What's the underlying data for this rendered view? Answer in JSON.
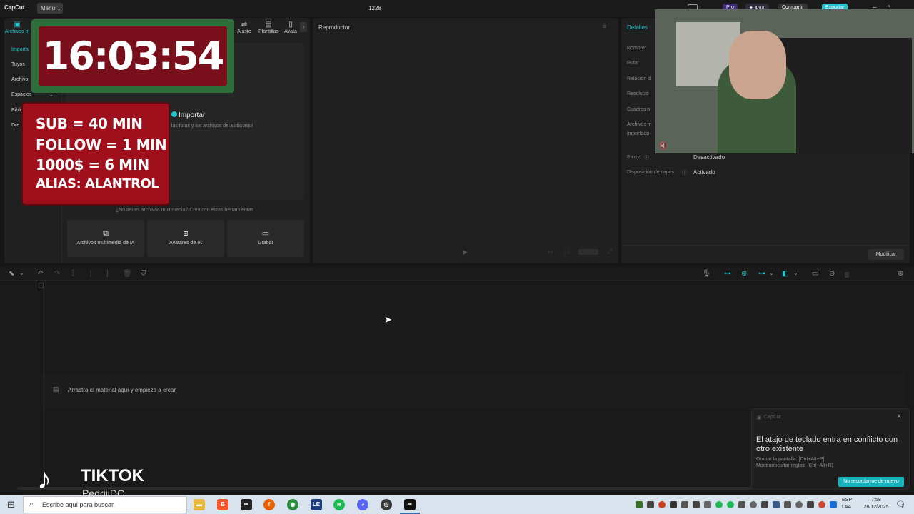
{
  "titlebar": {
    "logo": "CapCut",
    "menu_label": "Menú",
    "project_title": "1228",
    "pro_label": "Pro",
    "credits": "4600",
    "share_label": "Compartir",
    "export_label": "Exportar"
  },
  "media_panel": {
    "tabs": [
      {
        "label": "Archivos m",
        "icon": "media-icon"
      },
      {
        "label": "Ajuste",
        "icon": "adjust-icon"
      },
      {
        "label": "Plantillas",
        "icon": "templates-icon"
      },
      {
        "label": "Avata",
        "icon": "avatar-icon"
      }
    ],
    "sidebar": [
      "Importa",
      "Tuyos",
      "Archivo",
      "Espacios",
      "Bibli",
      "Dre"
    ],
    "import_label": "Importar",
    "import_hint": ", las fotos y los archivos de audio aquí",
    "no_media_text": "¿No tienes archivos multimedia? Crea con estas herramientas",
    "tools": [
      {
        "label": "Archivos multimedia de IA",
        "icon": "ai-media-icon"
      },
      {
        "label": "Avatares de IA",
        "icon": "ai-avatar-icon"
      },
      {
        "label": "Grabar",
        "icon": "record-icon"
      }
    ]
  },
  "player": {
    "title": "Reproductor"
  },
  "details": {
    "title": "Detalles",
    "labels": [
      "Nombre:",
      "Ruta:",
      "Relación d",
      "Resolució",
      "Cuadros p",
      "Archivos m",
      "importado"
    ],
    "proxy_label": "Proxy:",
    "proxy_value": "Desactivado",
    "layers_label": "Disposición de capas",
    "layers_value": "Activado",
    "modify_label": "Modificar"
  },
  "timeline": {
    "drop_hint": "Arrastra el material aquí y empieza a crear"
  },
  "toast": {
    "app": "CapCut",
    "title": "El atajo de teclado entra en conflicto con otro existente",
    "line1": "Grabar la pantalla: [Ctrl+Alt+P]",
    "line2": "Mostrar/ocultar reglas: [Ctrl+Alt+R]",
    "button": "No recordarme de nuevo"
  },
  "overlays": {
    "timer": "16:03:54",
    "rules": [
      "SUB = 40 MIN",
      "FOLLOW = 1 MIN",
      "1000$ = 6 MIN",
      "ALIAS: ALANTROL"
    ],
    "tiktok": "TIKTOK",
    "tiktok_user": "PedrijiDC"
  },
  "taskbar": {
    "search_placeholder": "Escribe aquí para buscar.",
    "lang1": "ESP",
    "lang2": "LAA",
    "time": "7:58",
    "date": "28/12/2025",
    "notifications": "2"
  },
  "colors": {
    "accent": "#20c4cb",
    "pro": "#6b3fd6",
    "toast_button": "#18b3ba"
  }
}
